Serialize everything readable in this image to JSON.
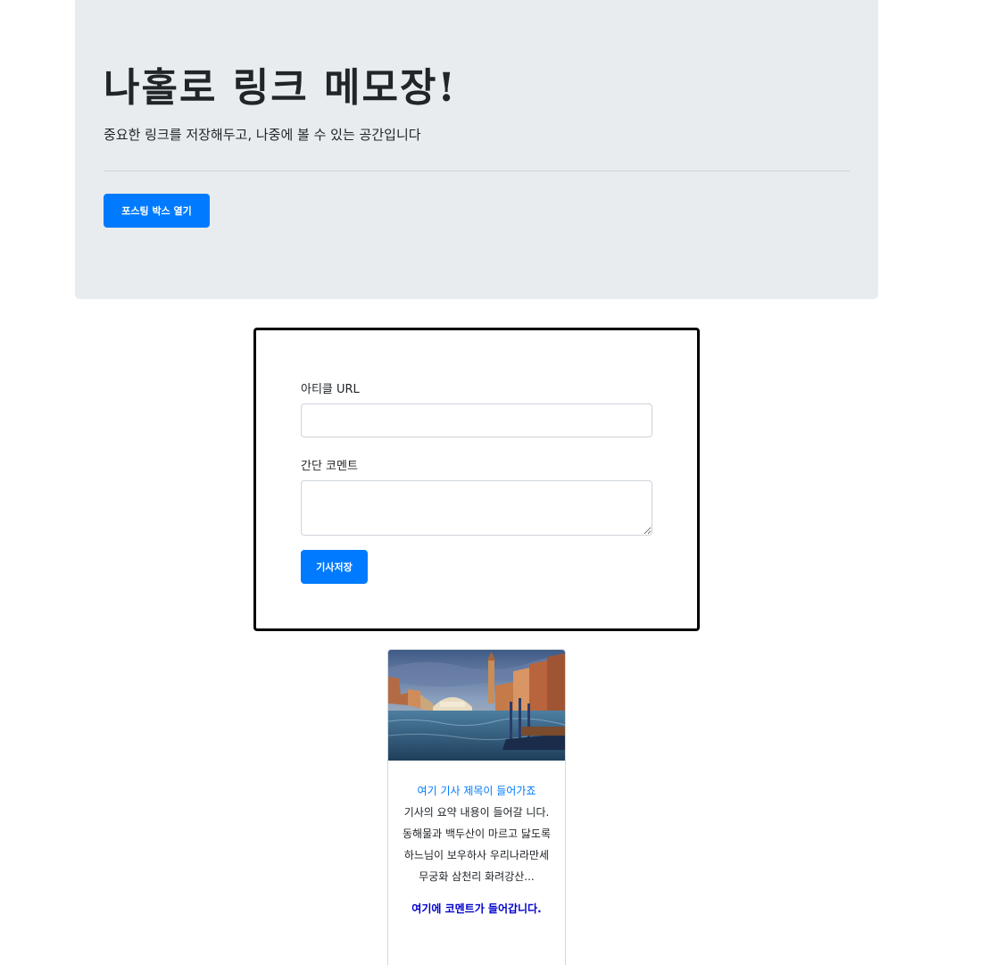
{
  "header": {
    "title": "나홀로 링크 메모장!",
    "lead": "중요한 링크를 저장해두고, 나중에 볼 수 있는 공간입니다",
    "open_button_label": "포스팅 박스 열기"
  },
  "posting_form": {
    "url_label": "아티클 URL",
    "url_value": "",
    "comment_label": "간단 코멘트",
    "comment_value": "",
    "save_button_label": "기사저장"
  },
  "cards": [
    {
      "image_description": "venice-canal-photo",
      "title": "여기 기사 제목이 들어가죠",
      "summary": "기사의 요약 내용이 들어갈 니다. 동해물과 백두산이 마르고 닳도록 하느님이 보우하사 우리나라만세 무궁화 삼천리 화려강산...",
      "comment": "여기에 코멘트가 들어갑니다."
    }
  ],
  "colors": {
    "primary": "#007bff",
    "jumbotron_bg": "#e9ecef",
    "comment_text": "#0000cc"
  }
}
